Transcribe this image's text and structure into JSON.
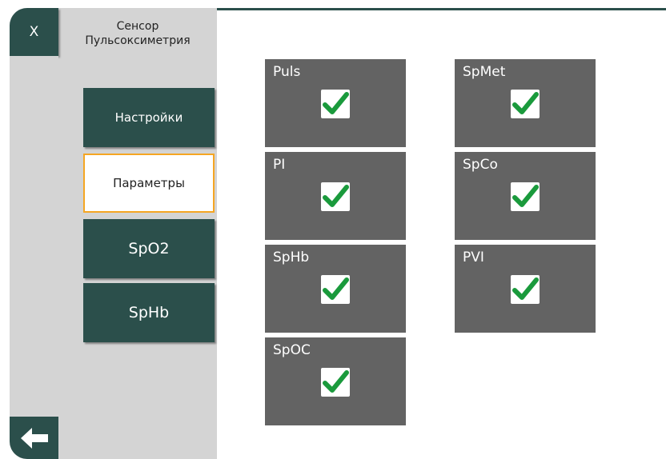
{
  "header": {
    "close_label": "X",
    "title_line1": "Сенсор",
    "title_line2": "Пульсоксиметрия"
  },
  "nav": {
    "settings": "Настройки",
    "parameters": "Параметры",
    "spo2": "SpO2",
    "sphb": "SpHb"
  },
  "tiles": [
    {
      "label": "Puls",
      "checked": true
    },
    {
      "label": "PI",
      "checked": true
    },
    {
      "label": "SpHb",
      "checked": true
    },
    {
      "label": "SpOC",
      "checked": true
    },
    {
      "label": "SpMet",
      "checked": true
    },
    {
      "label": "SpCo",
      "checked": true
    },
    {
      "label": "PVI",
      "checked": true
    }
  ],
  "icons": {
    "back": "back-arrow-icon",
    "check": "checkmark-icon"
  },
  "colors": {
    "accent": "#2b4f4b",
    "selected_border": "#f5a623",
    "tile_bg": "#636363",
    "check": "#1a9a3c"
  }
}
